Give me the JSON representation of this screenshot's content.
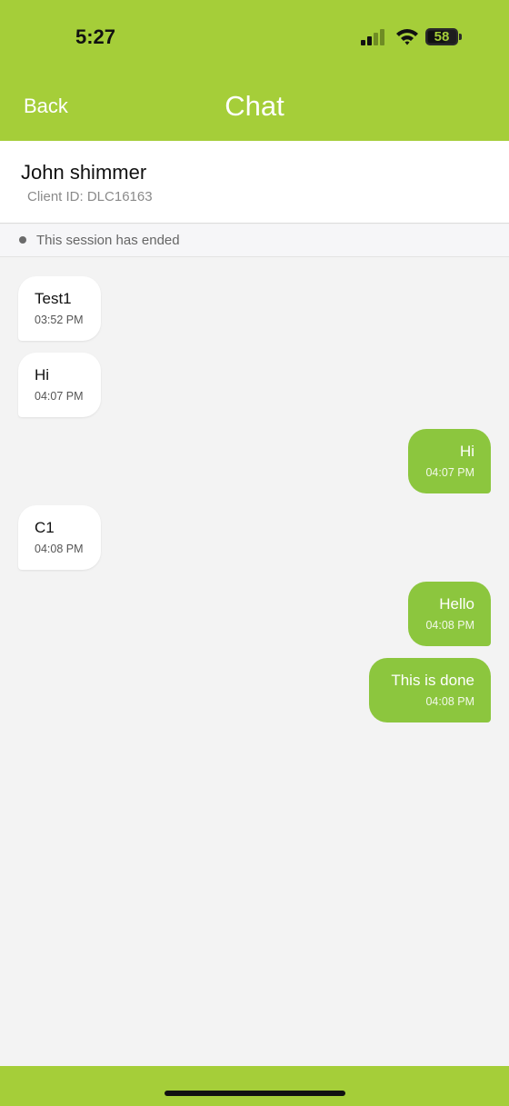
{
  "status_bar": {
    "time": "5:27",
    "battery": "58",
    "icons": [
      "signal-icon",
      "wifi-icon",
      "battery-icon"
    ]
  },
  "nav": {
    "back_label": "Back",
    "title": "Chat"
  },
  "contact": {
    "name": "John shimmer",
    "client_id": "Client ID: DLC16163"
  },
  "session": {
    "status_text": "This session has ended"
  },
  "messages": [
    {
      "direction": "incoming",
      "text": "Test1",
      "time": "03:52 PM"
    },
    {
      "direction": "incoming",
      "text": "Hi",
      "time": "04:07 PM"
    },
    {
      "direction": "outgoing",
      "text": "Hi",
      "time": "04:07 PM"
    },
    {
      "direction": "incoming",
      "text": "C1",
      "time": "04:08 PM"
    },
    {
      "direction": "outgoing",
      "text": "Hello",
      "time": "04:08 PM"
    },
    {
      "direction": "outgoing",
      "text": "This is done",
      "time": "04:08 PM"
    }
  ],
  "colors": {
    "brand": "#a5ce39",
    "outgoing_bubble": "#8cc63e",
    "incoming_bubble": "#ffffff",
    "background": "#f3f3f3"
  }
}
